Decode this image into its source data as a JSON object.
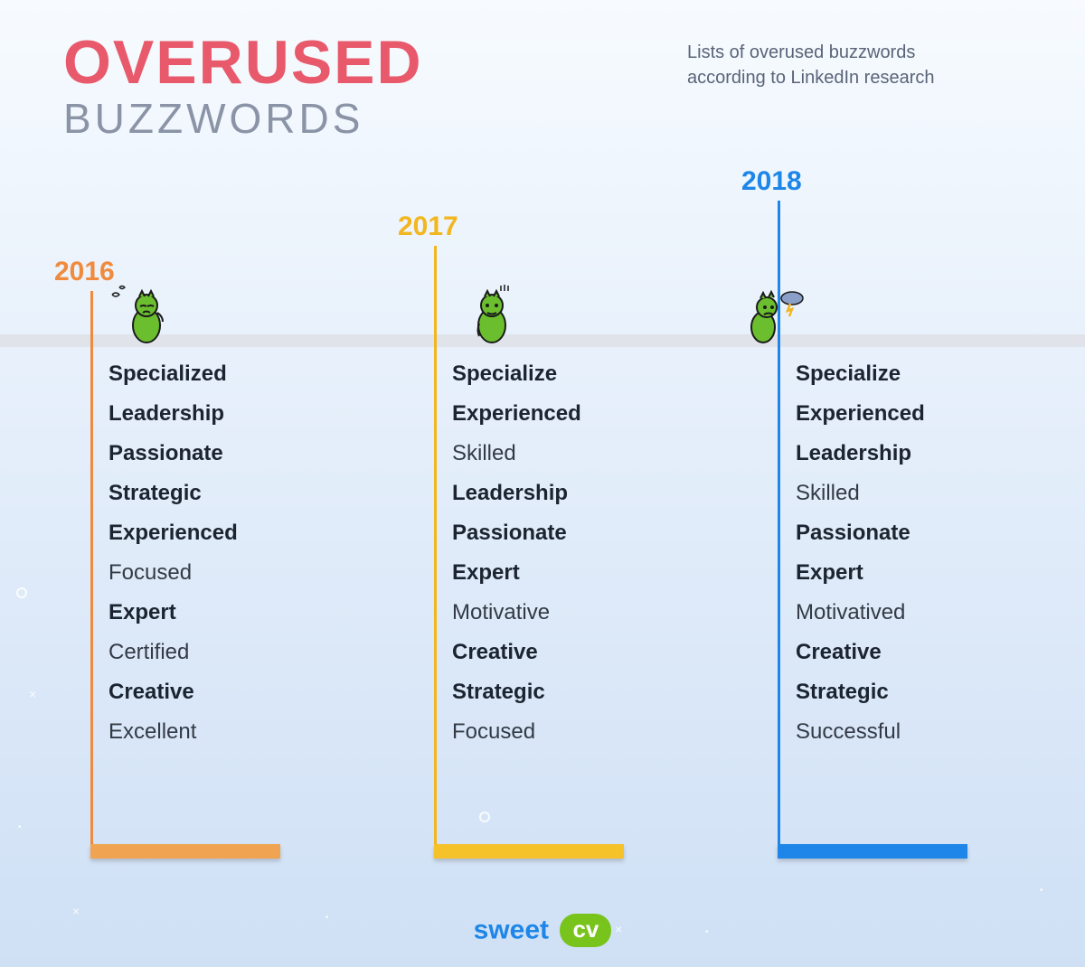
{
  "title_top": "OVERUSED",
  "title_bottom": "BUZZWORDS",
  "subtitle": "Lists of overused buzzwords according to LinkedIn research",
  "logo": {
    "brand": "sweet",
    "badge": "cv"
  },
  "colors": {
    "accent_2016": "#f08a3c",
    "accent_2017": "#f2b61e",
    "accent_2018": "#1d86e8",
    "title_red": "#e85a6b",
    "title_grey": "#8a94a6"
  },
  "columns": [
    {
      "year": "2016",
      "words": [
        {
          "text": "Specialized",
          "bold": true
        },
        {
          "text": "Leadership",
          "bold": true
        },
        {
          "text": "Passionate",
          "bold": true
        },
        {
          "text": "Strategic",
          "bold": true
        },
        {
          "text": "Experienced",
          "bold": true
        },
        {
          "text": "Focused",
          "bold": false
        },
        {
          "text": "Expert",
          "bold": true
        },
        {
          "text": "Certified",
          "bold": false
        },
        {
          "text": "Creative",
          "bold": true
        },
        {
          "text": "Excellent",
          "bold": false
        }
      ]
    },
    {
      "year": "2017",
      "words": [
        {
          "text": "Specialize",
          "bold": true
        },
        {
          "text": "Experienced",
          "bold": true
        },
        {
          "text": "Skilled",
          "bold": false
        },
        {
          "text": "Leadership",
          "bold": true
        },
        {
          "text": "Passionate",
          "bold": true
        },
        {
          "text": "Expert",
          "bold": true
        },
        {
          "text": "Motivative",
          "bold": false
        },
        {
          "text": "Creative",
          "bold": true
        },
        {
          "text": "Strategic",
          "bold": true
        },
        {
          "text": "Focused",
          "bold": false
        }
      ]
    },
    {
      "year": "2018",
      "words": [
        {
          "text": "Specialize",
          "bold": true
        },
        {
          "text": "Experienced",
          "bold": true
        },
        {
          "text": "Leadership",
          "bold": true
        },
        {
          "text": "Skilled",
          "bold": false
        },
        {
          "text": "Passionate",
          "bold": true
        },
        {
          "text": "Expert",
          "bold": true
        },
        {
          "text": "Motivatived",
          "bold": false
        },
        {
          "text": "Creative",
          "bold": true
        },
        {
          "text": "Strategic",
          "bold": true
        },
        {
          "text": "Successful",
          "bold": false
        }
      ]
    }
  ]
}
